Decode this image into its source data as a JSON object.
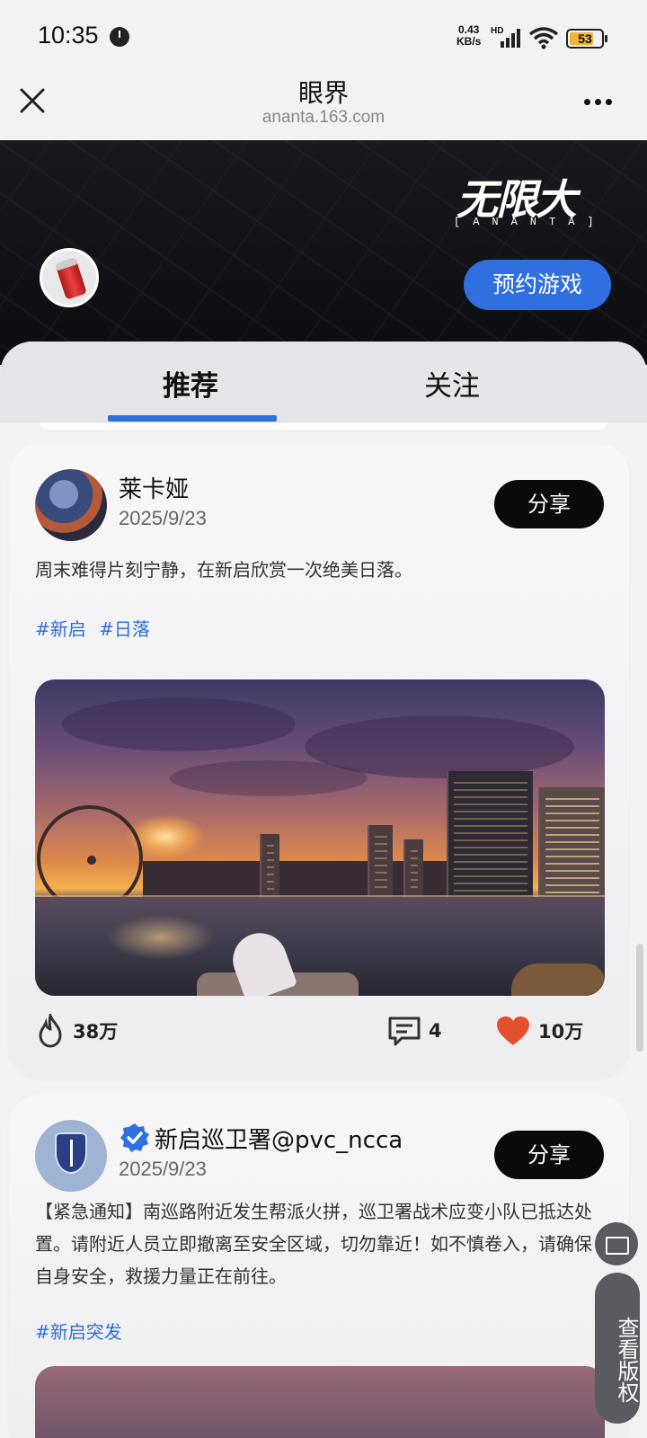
{
  "status_bar": {
    "time": "10:35",
    "speed_value": "0.43",
    "speed_unit": "KB/s",
    "hd": "HD",
    "battery": "53"
  },
  "title_bar": {
    "title": "眼界",
    "url": "ananta.163.com"
  },
  "banner": {
    "logo_text": "无限大",
    "logo_sub": "[ANANTA]",
    "reserve_label": "预约游戏"
  },
  "tabs": [
    {
      "label": "推荐",
      "active": true
    },
    {
      "label": "关注",
      "active": false
    }
  ],
  "posts": [
    {
      "author": "莱卡娅",
      "date": "2025/9/23",
      "share_label": "分享",
      "text": "周末难得片刻宁静，在新启欣赏一次绝美日落。",
      "tags": [
        "#新启",
        "#日落"
      ],
      "stats": {
        "views": "38万",
        "comments": "4",
        "likes": "10万"
      }
    },
    {
      "author": "新启巡卫署@pvc_ncca",
      "verified": true,
      "date": "2025/9/23",
      "share_label": "分享",
      "text": "【紧急通知】南巡路附近发生帮派火拼，巡卫署战术应变小队已抵达处置。请附近人员立即撤离至安全区域，切勿靠近！如不慎卷入，请确保自身安全，救援力量正在前往。",
      "tags": [
        "#新启突发"
      ]
    }
  ],
  "floating": {
    "copyright_label": "查看版权"
  },
  "colors": {
    "accent": "#2f6fe0",
    "like": "#e2502e",
    "share_bg": "#0a0a0a"
  }
}
